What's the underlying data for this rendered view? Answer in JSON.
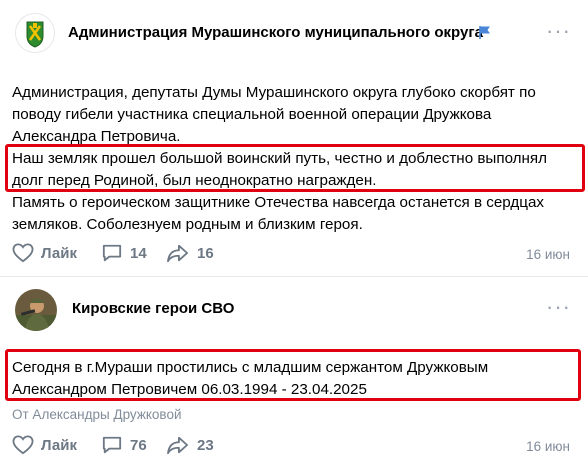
{
  "post1": {
    "group_name": "Администрация Мурашинского муниципального округа",
    "line1": "Администрация, депутаты Думы Мурашинского округа глубоко скорбят по",
    "line2": "поводу гибели участника специальной военной операции Дружкова",
    "line3": "Александра Петровича.",
    "line4": "Наш земляк прошел большой воинский путь, честно и доблестно выполнял",
    "line5": "долг перед Родиной, был неоднократно награжден.",
    "line6": "Память о героическом защитнике Отечества навсегда останется в сердцах",
    "line7": "земляков. Соболезнуем родным и близким героя.",
    "like_label": "Лайк",
    "comments": "14",
    "shares": "16",
    "date": "16 июн"
  },
  "post2": {
    "group_name": "Кировские герои СВО",
    "line1": "Сегодня в г.Мураши простились с младшим сержантом Дружковым",
    "line2": "Александром Петровичем 06.03.1994 - 23.04.2025",
    "from": "От Александры Дружковой",
    "like_label": "Лайк",
    "comments": "76",
    "shares": "23",
    "date": "16 июн"
  },
  "colors": {
    "highlight": "#e1000f",
    "icon_gray": "#6d7885",
    "verified_flag": "#4a86d8"
  },
  "icons": [
    "coat-of-arms-icon",
    "flag-icon",
    "more-icon",
    "heart-icon",
    "comment-icon",
    "share-icon"
  ]
}
